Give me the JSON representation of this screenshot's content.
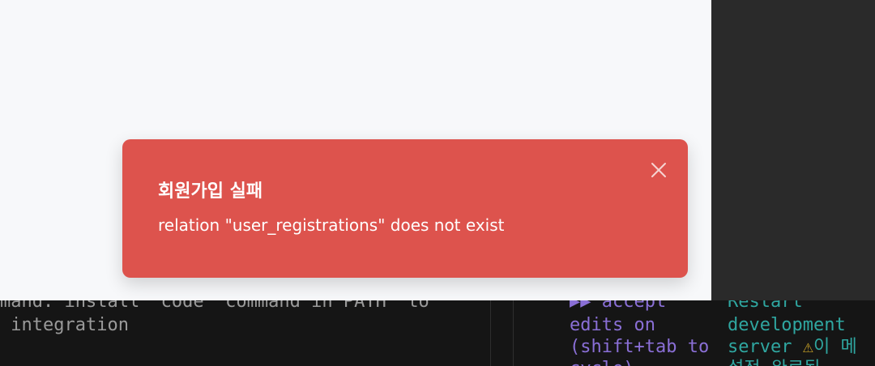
{
  "toast": {
    "title": "회원가입 실패",
    "message": "relation \"user_registrations\" does not exist",
    "close_icon": "close-icon",
    "color": "#dd534d"
  },
  "terminal": {
    "left": {
      "line1": "mand: install 'code' command in PATH  to",
      "line2": " integration"
    },
    "middle": {
      "line1": "▶▶ accept",
      "line2": "edits on",
      "line3": "(shift+tab to",
      "line4": "cycle)"
    },
    "right": {
      "line1": "Restart",
      "line2": "development",
      "line3": "server",
      "warning_icon": "warning-icon",
      "line3_suffix": "이 메",
      "line4": "설정 완료됨"
    }
  }
}
